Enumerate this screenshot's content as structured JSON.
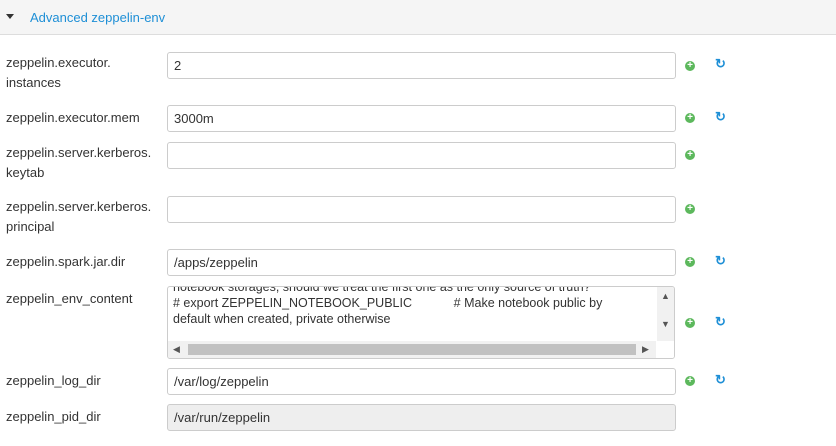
{
  "section": {
    "title": "Advanced zeppelin-env"
  },
  "fields": [
    {
      "label": "zeppelin.executor.",
      "label2": "instances",
      "value": "2"
    },
    {
      "label": "zeppelin.executor.mem",
      "value": "3000m"
    },
    {
      "label": "zeppelin.server.kerberos.",
      "label2": "keytab",
      "value": ""
    },
    {
      "label": "zeppelin.server.kerberos.",
      "label2": "principal",
      "value": ""
    },
    {
      "label": "zeppelin.spark.jar.dir",
      "value": "/apps/zeppelin"
    },
    {
      "label": "zeppelin_env_content",
      "lines": [
        "notebook storages, should we treat the first one as the only source of truth?",
        "# export ZEPPELIN_NOTEBOOK_PUBLIC            # Make notebook public by",
        "default when created, private otherwise"
      ]
    },
    {
      "label": "zeppelin_log_dir",
      "value": "/var/log/zeppelin"
    },
    {
      "label": "zeppelin_pid_dir",
      "value": "/var/run/zeppelin"
    }
  ],
  "icons": {
    "add": "+",
    "refresh": "↻"
  }
}
